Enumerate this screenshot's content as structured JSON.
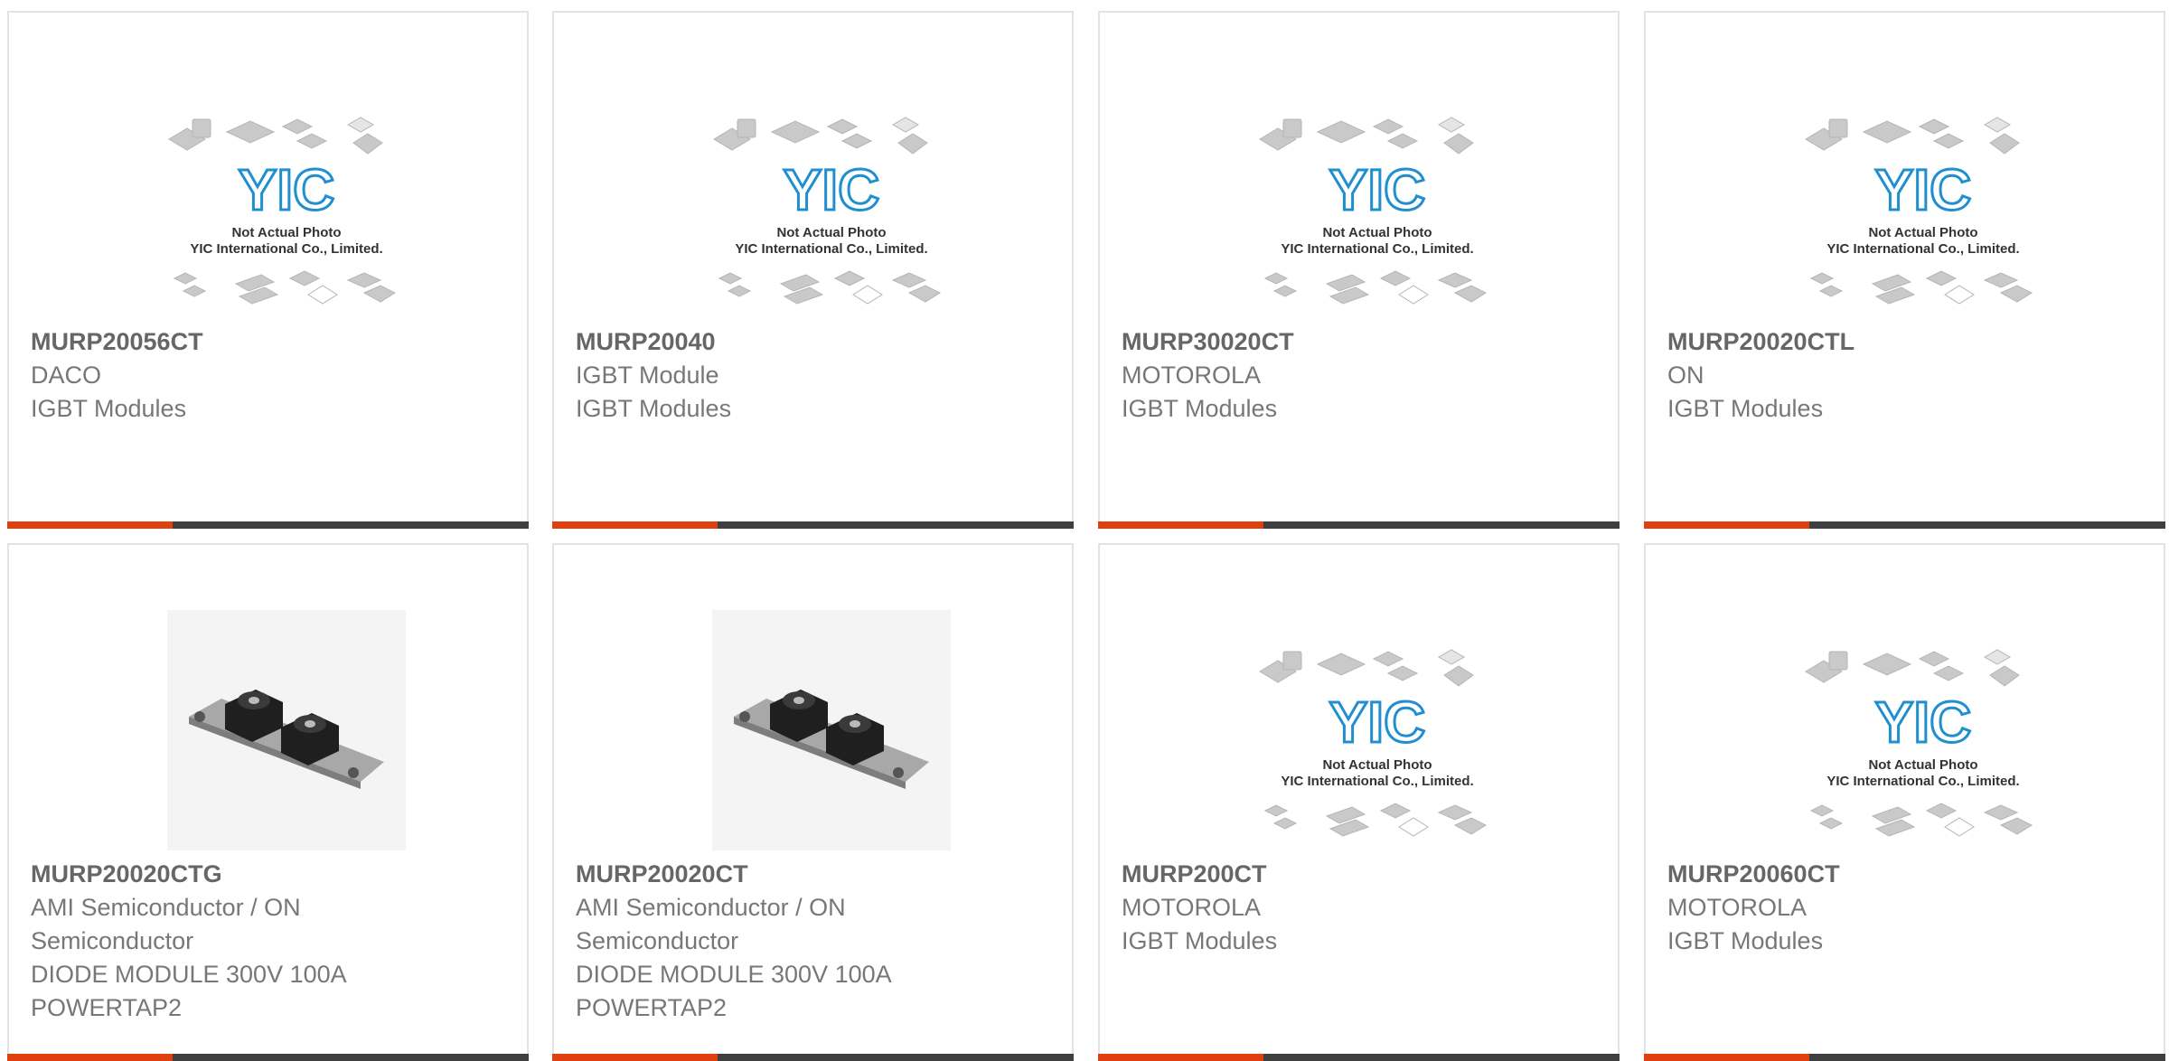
{
  "image_alt": {
    "placeholder_line1": "Not Actual Photo",
    "placeholder_line2": "YIC International Co., Limited.",
    "logo_text": "YIC"
  },
  "products": [
    {
      "part": "MURP20056CT",
      "lines": [
        "DACO",
        "IGBT Modules"
      ],
      "image": "placeholder"
    },
    {
      "part": "MURP20040",
      "lines": [
        "IGBT Module",
        "IGBT Modules"
      ],
      "image": "placeholder"
    },
    {
      "part": "MURP30020CT",
      "lines": [
        "MOTOROLA",
        "IGBT Modules"
      ],
      "image": "placeholder"
    },
    {
      "part": "MURP20020CTL",
      "lines": [
        "ON",
        "IGBT Modules"
      ],
      "image": "placeholder"
    },
    {
      "part": "MURP20020CTG",
      "lines": [
        "AMI Semiconductor / ON",
        "Semiconductor",
        "DIODE MODULE 300V 100A",
        "POWERTAP2"
      ],
      "image": "module"
    },
    {
      "part": "MURP20020CT",
      "lines": [
        "AMI Semiconductor / ON",
        "Semiconductor",
        "DIODE MODULE 300V 100A",
        "POWERTAP2"
      ],
      "image": "module"
    },
    {
      "part": "MURP200CT",
      "lines": [
        "MOTOROLA",
        "IGBT Modules"
      ],
      "image": "placeholder"
    },
    {
      "part": "MURP20060CT",
      "lines": [
        "MOTOROLA",
        "IGBT Modules"
      ],
      "image": "placeholder"
    }
  ],
  "colors": {
    "accent": "#e0400f",
    "bar": "#3f3f3f",
    "border": "#e3e3e3",
    "logo": "#1f8fcf"
  }
}
